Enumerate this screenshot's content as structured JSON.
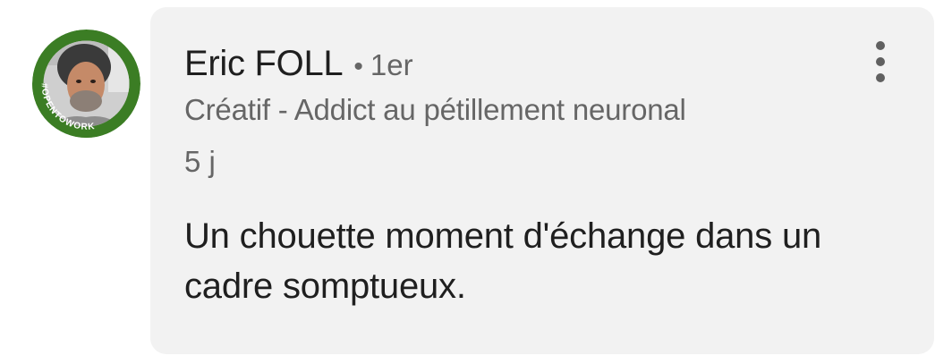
{
  "comment": {
    "author": {
      "name": "Eric FOLL",
      "separator": "•",
      "degree": "1er",
      "headline": "Créatif - Addict au pétillement neuronal",
      "badge_text": "#OPENTOWORK",
      "badge_color": "#3b7d24"
    },
    "timestamp": "5 j",
    "text": "Un chouette moment d'échange dans un cadre somptueux.",
    "more_icon": "more-vertical-icon",
    "bubble_color": "#f2f2f2"
  }
}
